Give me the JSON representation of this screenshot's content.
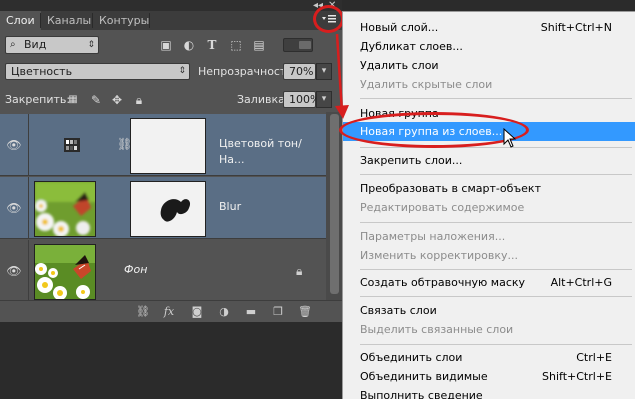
{
  "tabs": [
    {
      "label": "Слои",
      "active": true
    },
    {
      "label": "Каналы",
      "active": false
    },
    {
      "label": "Контуры",
      "active": false
    }
  ],
  "window_controls": {
    "collapse": "◂◂",
    "close": "✕"
  },
  "panel_menu_icon": "panel-menu-icon",
  "filter": {
    "label": "Вид",
    "icons": [
      "image-filter-icon",
      "adjustment-filter-icon",
      "type-filter-icon",
      "shape-filter-icon",
      "smart-object-filter-icon",
      "toggle-filter-icon"
    ]
  },
  "blend": {
    "mode": "Цветность",
    "opacity_label": "Непрозрачность:",
    "opacity": "70%"
  },
  "lock": {
    "label": "Закрепить:",
    "fill_label": "Заливка:",
    "fill": "100%"
  },
  "layers": [
    {
      "name": "Цветовой тон/На...",
      "selected": true
    },
    {
      "name": "Blur",
      "selected": true
    },
    {
      "name": "Фон",
      "selected": false
    }
  ],
  "menu": {
    "items": [
      {
        "label": "Новый слой...",
        "shortcut": "Shift+Ctrl+N",
        "disabled": false
      },
      {
        "label": "Дубликат слоев...",
        "shortcut": "",
        "disabled": false
      },
      {
        "label": "Удалить слои",
        "shortcut": "",
        "disabled": false
      },
      {
        "label": "Удалить скрытые слои",
        "shortcut": "",
        "disabled": true
      },
      {
        "label": "Новая группа",
        "shortcut": "",
        "disabled": false
      },
      {
        "label": "Новая группа из слоев...",
        "shortcut": "",
        "disabled": false,
        "highlighted": true
      },
      {
        "label": "Закрепить слои...",
        "shortcut": "",
        "disabled": false
      },
      {
        "label": "Преобразовать в смарт-объект",
        "shortcut": "",
        "disabled": false
      },
      {
        "label": "Редактировать содержимое",
        "shortcut": "",
        "disabled": true
      },
      {
        "label": "Параметры наложения...",
        "shortcut": "",
        "disabled": true
      },
      {
        "label": "Изменить корректировку...",
        "shortcut": "",
        "disabled": true
      },
      {
        "label": "Создать обтравочную маску",
        "shortcut": "Alt+Ctrl+G",
        "disabled": false
      },
      {
        "label": "Связать слои",
        "shortcut": "",
        "disabled": false
      },
      {
        "label": "Выделить связанные слои",
        "shortcut": "",
        "disabled": true
      },
      {
        "label": "Объединить слои",
        "shortcut": "Ctrl+E",
        "disabled": false
      },
      {
        "label": "Объединить видимые",
        "shortcut": "Shift+Ctrl+E",
        "disabled": false
      },
      {
        "label": "Выполнить сведение",
        "shortcut": "",
        "disabled": false
      }
    ]
  },
  "colors": {
    "highlight": "#3399ff",
    "annotation": "#d81e1e",
    "selected_layer": "#5a6e85"
  }
}
